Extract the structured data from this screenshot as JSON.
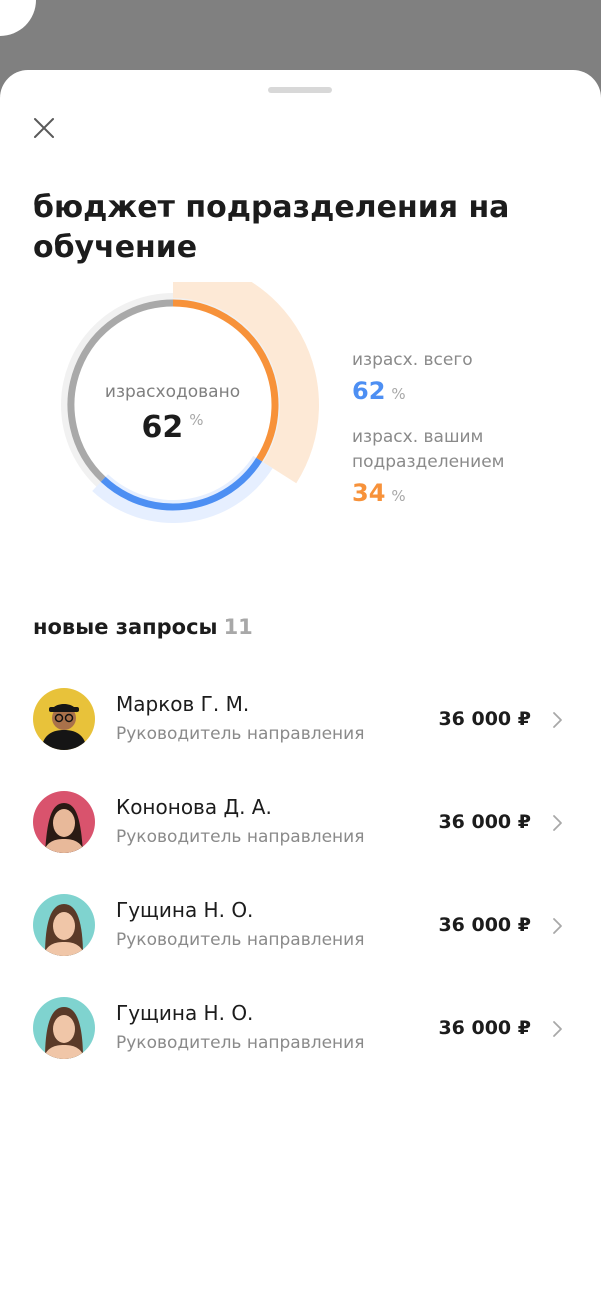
{
  "sheet": {
    "title": "бюджет подразделения на обучение"
  },
  "budget_chart": {
    "center_label": "израсходовано",
    "center_value": "62",
    "center_unit": "%",
    "total_spent_percent": 62,
    "department_spent_percent": 34,
    "colors": {
      "total": "#4d8ff3",
      "department": "#f7923a",
      "remaining": "#a9a9a9"
    }
  },
  "legend": {
    "total_label": "израсх. всего",
    "total_value": "62",
    "total_unit": "%",
    "department_label_line1": "израсх. вашим",
    "department_label_line2": "подразделением",
    "department_value": "34",
    "department_unit": "%"
  },
  "requests": {
    "title": "новые запросы",
    "count": "11",
    "items": [
      {
        "name": "Марков Г. М.",
        "role": "Руководитель направления",
        "amount": "36 000 ₽",
        "avatar_bg": "#e8c23a"
      },
      {
        "name": "Кононова Д. А.",
        "role": "Руководитель направления",
        "amount": "36 000 ₽",
        "avatar_bg": "#d9536d"
      },
      {
        "name": "Гущина Н. О.",
        "role": "Руководитель направления",
        "amount": "36 000 ₽",
        "avatar_bg": "#7fd3cf"
      },
      {
        "name": "Гущина Н. О.",
        "role": "Руководитель направления",
        "amount": "36 000 ₽",
        "avatar_bg": "#7fd3cf"
      }
    ]
  }
}
